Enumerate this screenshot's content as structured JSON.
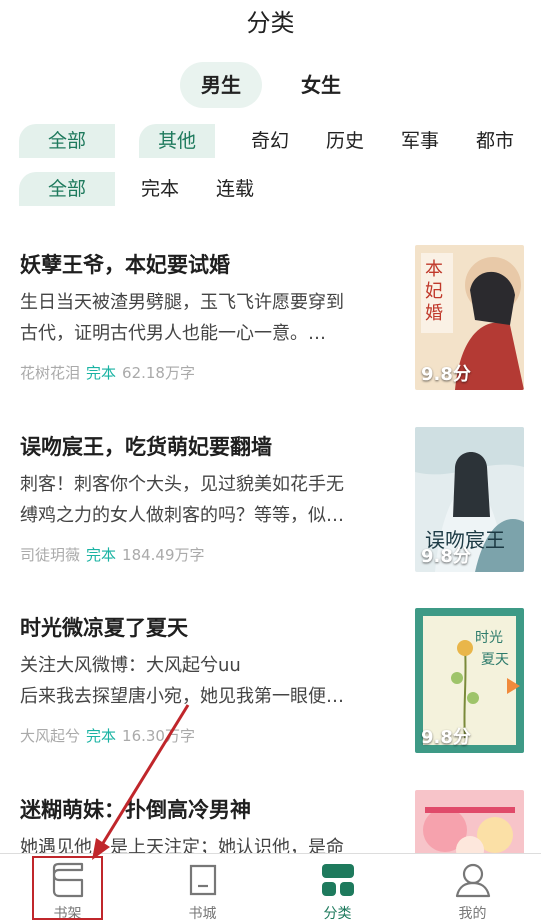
{
  "header": {
    "title": "分类"
  },
  "gender_tabs": [
    {
      "label": "男生",
      "active": true
    },
    {
      "label": "女生",
      "active": false
    }
  ],
  "category_filters": [
    "全部",
    "其他",
    "奇幻",
    "历史",
    "军事",
    "都市"
  ],
  "status_filters": [
    "全部",
    "完本",
    "连载"
  ],
  "books": [
    {
      "title": "妖孽王爷，本妃要试婚",
      "desc_line1": "生日当天被渣男劈腿，玉飞飞许愿要穿到",
      "desc_line2": "古代，证明古代男人也能一心一意。…",
      "author": "花树花泪",
      "status": "完本",
      "words": "62.18万字",
      "score": "9.8分",
      "cover_colors": [
        "#f3e2c9",
        "#c0392b"
      ]
    },
    {
      "title": "误吻宸王，吃货萌妃要翻墙",
      "desc_line1": "刺客！刺客你个大头，见过貌美如花手无",
      "desc_line2": "缚鸡之力的女人做刺客的吗？等等，似…",
      "author": "司徒玥薇",
      "status": "完本",
      "words": "184.49万字",
      "score": "9.8分",
      "cover_colors": [
        "#dfe9ec",
        "#3d6a7a"
      ]
    },
    {
      "title": "时光微凉夏了夏天",
      "desc_line1": "关注大风微博：大风起兮uu",
      "desc_line2": "后来我去探望唐小宛，她见我第一眼便…",
      "author": "大风起兮",
      "status": "完本",
      "words": "16.30万字",
      "score": "9.8分",
      "cover_colors": [
        "#3e9a86",
        "#f3f1d6"
      ]
    },
    {
      "title": "迷糊萌妹：扑倒高冷男神",
      "desc_line1": "她遇见他，是上天注定；她认识他，是命",
      "desc_line2": "",
      "author": "",
      "status": "",
      "words": "",
      "score": "",
      "cover_colors": [
        "#f7c4c9",
        "#e04a6a"
      ]
    }
  ],
  "bottom_nav": [
    {
      "label": "书架",
      "icon": "bookshelf-icon",
      "active": false
    },
    {
      "label": "书城",
      "icon": "bookstore-icon",
      "active": false
    },
    {
      "label": "分类",
      "icon": "category-icon",
      "active": true
    },
    {
      "label": "我的",
      "icon": "profile-icon",
      "active": false
    }
  ],
  "colors": {
    "accent": "#1e7a5d",
    "status": "#1ab3a3",
    "highlight": "#c0262b"
  }
}
